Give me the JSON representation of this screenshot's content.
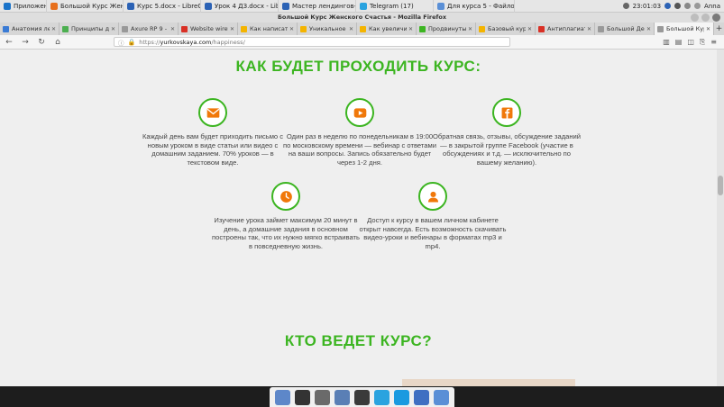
{
  "system_panel": {
    "items": [
      {
        "label": "Приложения",
        "icon": "apps-icon",
        "color": "#1a73c9"
      },
      {
        "label": "Большой Курс Женско...",
        "icon": "firefox-icon",
        "color": "#e76f1c"
      },
      {
        "label": "Курс 5.docx - LibreOffic...",
        "icon": "document-icon",
        "color": "#2b62b5"
      },
      {
        "label": "Урок 4 ДЗ.docx - LibreO...",
        "icon": "document-icon",
        "color": "#2b62b5"
      },
      {
        "label": "Мастер лендингов- ви...",
        "icon": "document-icon",
        "color": "#2b62b5"
      },
      {
        "label": "Telegram (17)",
        "icon": "telegram-icon",
        "color": "#2aa3df"
      },
      {
        "label": "Для курса 5 - Файлов...",
        "icon": "folder-icon",
        "color": "#5a8fd6"
      }
    ],
    "clock": "23:01:03",
    "user": "Anna"
  },
  "window": {
    "title": "Большой Курс Женского Счастья - Mozilla Firefox"
  },
  "tabs": [
    {
      "label": "Анатомия лен",
      "color": "#3a7bd5",
      "active": false
    },
    {
      "label": "Принципы ди",
      "color": "#4caf50",
      "active": false
    },
    {
      "label": "Axure RP 9 - P",
      "color": "#999999",
      "active": false
    },
    {
      "label": "Website wirefr",
      "color": "#d93025",
      "active": false
    },
    {
      "label": "Как написать",
      "color": "#f4b400",
      "active": false
    },
    {
      "label": "Уникальное т",
      "color": "#f4b400",
      "active": false
    },
    {
      "label": "Как увеличит",
      "color": "#f4b400",
      "active": false
    },
    {
      "label": "Продвинутый",
      "color": "#3cb521",
      "active": false
    },
    {
      "label": "Базовый курс ди",
      "color": "#f4b400",
      "active": false
    },
    {
      "label": "Антиплагиат",
      "color": "#d93025",
      "active": false
    },
    {
      "label": "Большой Денег",
      "color": "#999999",
      "active": false
    },
    {
      "label": "Большой Курс Ж",
      "color": "#999999",
      "active": true
    }
  ],
  "nav": {
    "url_host": "yurkovskaya.com",
    "url_path": "/happiness/",
    "url_scheme": "https://"
  },
  "page": {
    "section_title": "КАК БУДЕТ ПРОХОДИТЬ КУРС:",
    "features": [
      {
        "icon": "email-icon",
        "text": "Каждый день вам будет приходить письмо с новым уроком в виде статьи или видео с домашним заданием. 70% уроков — в текстовом виде."
      },
      {
        "icon": "youtube-icon",
        "text": "Один раз в неделю по понедельникам в 19:00 по московскому времени — вебинар с ответами на ваши вопросы. Запись обязательно будет через 1-2 дня."
      },
      {
        "icon": "facebook-icon",
        "text": "Обратная связь, отзывы, обсуждение заданий — в закрытой группе Facebook (участие в обсуждениях и т.д. — исключительно по вашему желанию)."
      },
      {
        "icon": "clock-icon",
        "text": "Изучение урока займет максимум 20 минут в день, а домашние задания в основном построены так, что их нужно мягко встраивать в повседневную жизнь."
      },
      {
        "icon": "user-icon",
        "text": "Доступ к курсу в вашем личном кабинете открыт навсегда. Есть возможность скачивать видео-уроки и вебинары в форматах mp3 и mp4."
      }
    ],
    "next_title": "КТО ВЕДЕТ КУРС?",
    "accent_color": "#3cb521",
    "icon_color": "#f0780a"
  },
  "dock": [
    {
      "icon": "files-icon",
      "color": "#5d87c9"
    },
    {
      "icon": "terminal-icon",
      "color": "#333333"
    },
    {
      "icon": "file-manager-icon",
      "color": "#6a6a6a"
    },
    {
      "icon": "browser-globe-icon",
      "color": "#5a7fb5"
    },
    {
      "icon": "search-icon",
      "color": "#3a3a3a"
    },
    {
      "icon": "telegram-icon",
      "color": "#2aa3df"
    },
    {
      "icon": "skype-icon",
      "color": "#1a9ae0"
    },
    {
      "icon": "document-icon",
      "color": "#3f6fc2"
    },
    {
      "icon": "folder-icon",
      "color": "#5a8fd6"
    }
  ]
}
